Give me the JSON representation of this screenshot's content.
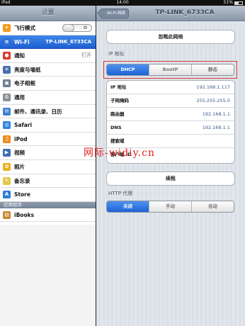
{
  "status": {
    "device": "iPad",
    "time": "14:00",
    "battery": "51%"
  },
  "sidebar": {
    "title": "设置",
    "items": [
      {
        "label": "飞行模式",
        "value": "O",
        "icon": "airplane-icon",
        "color": "#f29b1d",
        "glyph": "✈"
      },
      {
        "label": "Wi-Fi",
        "value": "TP-LINK_6733CA",
        "icon": "wifi-icon",
        "color": "#2f6fd8",
        "glyph": "≋"
      },
      {
        "label": "通知",
        "value": "打开",
        "icon": "notifications-icon",
        "color": "#d93a2b",
        "glyph": "●"
      },
      {
        "label": "亮度与墙纸",
        "value": "",
        "icon": "brightness-icon",
        "color": "#4a6fb0",
        "glyph": "☀"
      },
      {
        "label": "电子相框",
        "value": "",
        "icon": "picture-frame-icon",
        "color": "#6b7a8f",
        "glyph": "▣"
      },
      {
        "label": "通用",
        "value": "",
        "icon": "gear-icon",
        "color": "#8a8f96",
        "glyph": "⚙"
      },
      {
        "label": "邮件、通讯录、日历",
        "value": "",
        "icon": "mail-icon",
        "color": "#3f7fd0",
        "glyph": "✉"
      },
      {
        "label": "Safari",
        "value": "",
        "icon": "safari-icon",
        "color": "#2e86de",
        "glyph": "◎"
      },
      {
        "label": "iPod",
        "value": "",
        "icon": "ipod-icon",
        "color": "#f08a1c",
        "glyph": "♫"
      },
      {
        "label": "视频",
        "value": "",
        "icon": "video-icon",
        "color": "#3b6fb6",
        "glyph": "▶"
      },
      {
        "label": "照片",
        "value": "",
        "icon": "photos-icon",
        "color": "#e9b21c",
        "glyph": "✿"
      },
      {
        "label": "备忘录",
        "value": "",
        "icon": "notes-icon",
        "color": "#e5c84a",
        "glyph": "✎"
      },
      {
        "label": "Store",
        "value": "",
        "icon": "store-icon",
        "color": "#2d7fd6",
        "glyph": "A"
      }
    ],
    "group_header": "应用程序",
    "apps": [
      {
        "label": "iBooks",
        "icon": "ibooks-icon",
        "color": "#c9862c",
        "glyph": "▤"
      }
    ]
  },
  "nav": {
    "back_label": "Wi-Fi 网络",
    "title": "TP-LINK_6733CA"
  },
  "forget_button": "忽略此网络",
  "ip_section": {
    "label": "IP 地址",
    "segments": [
      "DHCP",
      "BootP",
      "静态"
    ],
    "selected": "DHCP",
    "rows": [
      {
        "label": "IP 地址",
        "value": "192.168.1.117"
      },
      {
        "label": "子网掩码",
        "value": "255.255.255.0"
      },
      {
        "label": "路由器",
        "value": "192.168.1.1"
      },
      {
        "label": "DNS",
        "value": "192.168.1.1"
      },
      {
        "label": "搜索域",
        "value": ""
      },
      {
        "label": "客户端 ID",
        "value": ""
      }
    ]
  },
  "renew_button": "续租",
  "proxy": {
    "label": "HTTP 代理",
    "segments": [
      "关闭",
      "手动",
      "自动"
    ],
    "selected": "关闭"
  },
  "watermark": "网际-widiy.cn",
  "colors": {
    "selected_blue": "#1d63d6",
    "highlight_red": "#d13b3b"
  }
}
